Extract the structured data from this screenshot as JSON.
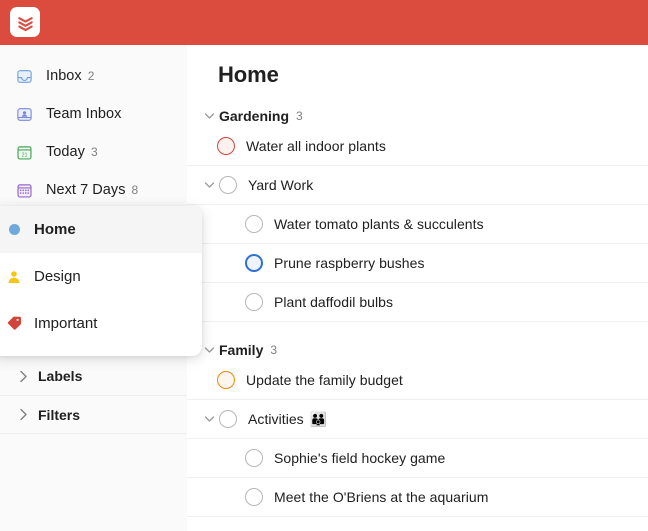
{
  "topbar": {
    "logo_name": "todoist-logo"
  },
  "sidebar": {
    "nav": [
      {
        "label": "Inbox",
        "count": "2",
        "icon": "inbox-icon"
      },
      {
        "label": "Team Inbox",
        "count": "",
        "icon": "team-inbox-icon"
      },
      {
        "label": "Today",
        "count": "3",
        "icon": "calendar-today-icon"
      },
      {
        "label": "Next 7 Days",
        "count": "8",
        "icon": "calendar-week-icon"
      }
    ],
    "groups": [
      {
        "label": "Labels",
        "icon": "chevron-right-icon"
      },
      {
        "label": "Filters",
        "icon": "chevron-right-icon"
      }
    ]
  },
  "popup": {
    "items": [
      {
        "label": "Home",
        "icon": "project-dot-icon",
        "color": "#6fa8dc",
        "active": true
      },
      {
        "label": "Design",
        "icon": "shared-person-icon",
        "color": "#f5c518",
        "active": false
      },
      {
        "label": "Important",
        "icon": "label-tag-icon",
        "color": "#d1453b",
        "active": false
      }
    ]
  },
  "main": {
    "title": "Home",
    "sections": [
      {
        "name": "Gardening",
        "count": "3",
        "tasks": [
          {
            "text": "Water all indoor plants",
            "checkbox": "red",
            "indent": 1,
            "expandable": false,
            "emoji": ""
          },
          {
            "text": "Yard Work",
            "checkbox": "grey",
            "indent": 0,
            "expandable": true,
            "emoji": ""
          },
          {
            "text": "Water tomato plants & succulents",
            "checkbox": "grey",
            "indent": 2,
            "expandable": false,
            "emoji": ""
          },
          {
            "text": "Prune raspberry bushes",
            "checkbox": "blue",
            "indent": 2,
            "expandable": false,
            "emoji": ""
          },
          {
            "text": "Plant daffodil bulbs",
            "checkbox": "grey",
            "indent": 2,
            "expandable": false,
            "emoji": ""
          }
        ]
      },
      {
        "name": "Family",
        "count": "3",
        "tasks": [
          {
            "text": "Update the family budget",
            "checkbox": "orange",
            "indent": 1,
            "expandable": false,
            "emoji": ""
          },
          {
            "text": "Activities",
            "checkbox": "grey",
            "indent": 0,
            "expandable": true,
            "emoji": "👪"
          },
          {
            "text": "Sophie's field hockey game",
            "checkbox": "grey",
            "indent": 2,
            "expandable": false,
            "emoji": ""
          },
          {
            "text": "Meet the O'Briens at the aquarium",
            "checkbox": "grey",
            "indent": 2,
            "expandable": false,
            "emoji": ""
          }
        ]
      }
    ]
  },
  "colors": {
    "brand_red": "#dc4c3e",
    "sidebar_bg": "#fafafa",
    "checkbox_red": "#d1453b",
    "checkbox_blue": "#2e6fd9",
    "checkbox_orange": "#eb8909"
  }
}
